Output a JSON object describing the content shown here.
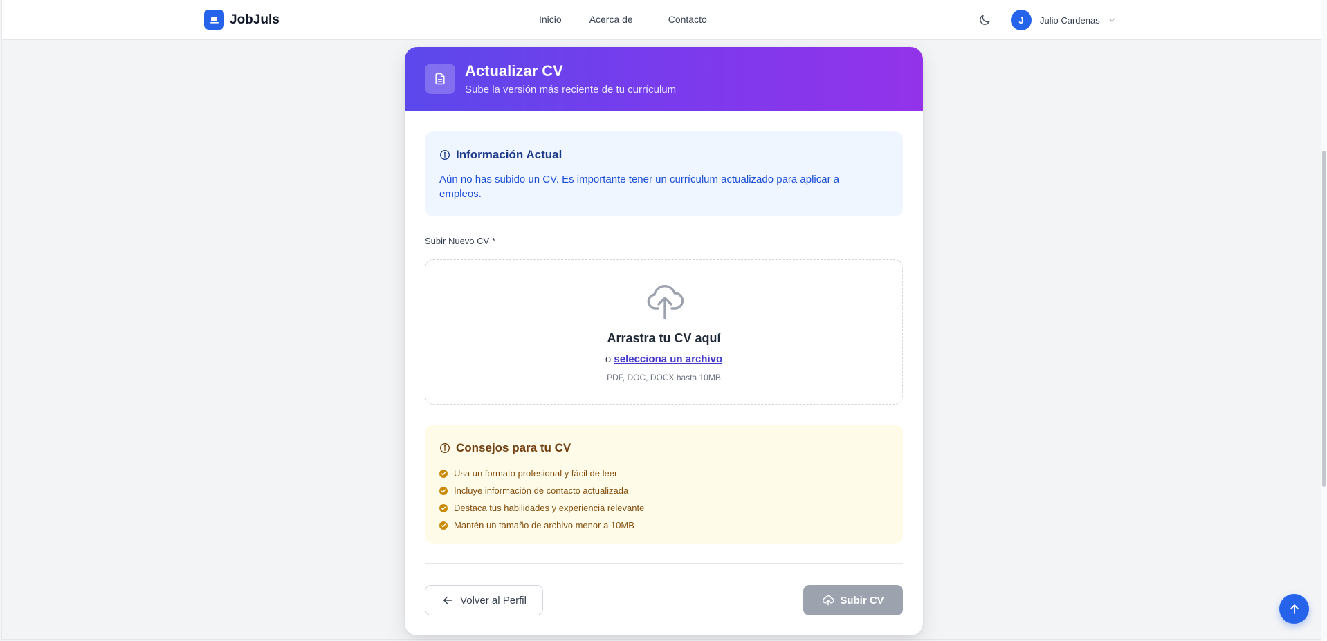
{
  "navbar": {
    "brand": "JobJuls",
    "links": [
      "Inicio",
      "Acerca de",
      "Contacto"
    ],
    "user": {
      "initial": "J",
      "name": "Julio Cardenas"
    }
  },
  "header": {
    "title": "Actualizar CV",
    "subtitle": "Sube la versión más reciente de tu currículum"
  },
  "info": {
    "title": "Información Actual",
    "text": "Aún no has subido un CV. Es importante tener un currículum actualizado para aplicar a empleos."
  },
  "upload": {
    "label": "Subir Nuevo CV *",
    "drop_title": "Arrastra tu CV aquí",
    "or": "o",
    "select_link": "selecciona un archivo",
    "hint": "PDF, DOC, DOCX hasta 10MB"
  },
  "tips": {
    "title": "Consejos para tu CV",
    "items": [
      "Usa un formato profesional y fácil de leer",
      "Incluye información de contacto actualizada",
      "Destaca tus habilidades y experiencia relevante",
      "Mantén un tamaño de archivo menor a 10MB"
    ]
  },
  "actions": {
    "back_label": "Volver al Perfil",
    "submit_label": "Subir CV"
  },
  "colors": {
    "accent": "#2563eb",
    "gradient_start": "#5b49ec",
    "gradient_end": "#9333ea",
    "submit_disabled": "#9ca3af"
  }
}
